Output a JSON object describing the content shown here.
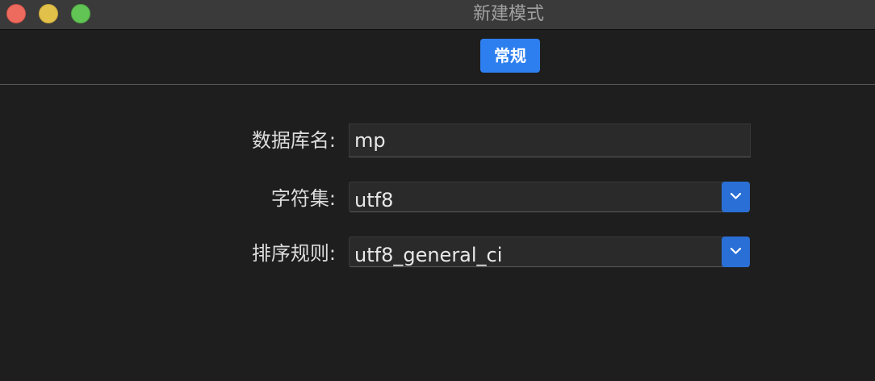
{
  "window": {
    "title": "新建模式"
  },
  "toolbar": {
    "tab_general_label": "常规"
  },
  "form": {
    "database_name": {
      "label": "数据库名:",
      "value": "mp"
    },
    "charset": {
      "label": "字符集:",
      "value": "utf8"
    },
    "collation": {
      "label": "排序规则:",
      "value": "utf8_general_ci"
    }
  },
  "colors": {
    "accent": "#2d7ff0",
    "background": "#1e1e1e",
    "titlebar": "#3a3a3a",
    "close": "#ed6a5e",
    "minimize": "#e2c14a",
    "maximize": "#61c454"
  },
  "icons": {
    "dropdown": "chevron-down-icon"
  }
}
